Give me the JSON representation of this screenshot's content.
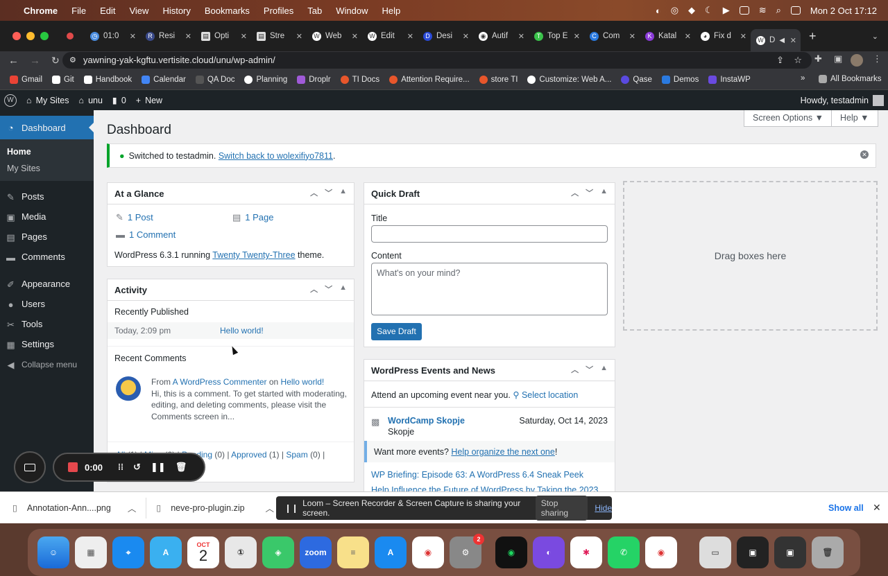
{
  "menubar": {
    "app": "Chrome",
    "menus": [
      "File",
      "Edit",
      "View",
      "History",
      "Bookmarks",
      "Profiles",
      "Tab",
      "Window",
      "Help"
    ],
    "datetime": "Mon 2 Oct  17:12"
  },
  "tabs": [
    {
      "label": "01:0",
      "icon": "clock-icon"
    },
    {
      "label": "Resi",
      "icon": "rm-icon"
    },
    {
      "label": "Opti",
      "icon": "doc-icon"
    },
    {
      "label": "Stre",
      "icon": "doc-icon"
    },
    {
      "label": "Web",
      "icon": "wordpress-icon"
    },
    {
      "label": "Edit",
      "icon": "wordpress-icon"
    },
    {
      "label": "Desi",
      "icon": "d-icon"
    },
    {
      "label": "Autif",
      "icon": "autify-icon"
    },
    {
      "label": "Top E",
      "icon": "top-icon"
    },
    {
      "label": "Com",
      "icon": "c-icon"
    },
    {
      "label": "Katal",
      "icon": "k-icon"
    },
    {
      "label": "Fix d",
      "icon": "github-icon"
    },
    {
      "label": "D",
      "icon": "wordpress-icon"
    }
  ],
  "address": "yawning-yak-kgftu.vertisite.cloud/unu/wp-admin/",
  "bookmarks": [
    {
      "label": "Gmail",
      "color": "#ea4335"
    },
    {
      "label": "Git",
      "color": "#ffffff"
    },
    {
      "label": "Handbook",
      "color": "#ffffff"
    },
    {
      "label": "Calendar",
      "color": "#4285f4"
    },
    {
      "label": "QA Doc",
      "color": "#888888"
    },
    {
      "label": "Planning",
      "color": "#ffffff"
    },
    {
      "label": "Droplr",
      "color": "#a05ad8"
    },
    {
      "label": "TI Docs",
      "color": "#e8562b"
    },
    {
      "label": "Attention Require...",
      "color": "#e8562b"
    },
    {
      "label": "store TI",
      "color": "#e8562b"
    },
    {
      "label": "Customize: Web A...",
      "color": "#ffffff"
    },
    {
      "label": "Qase",
      "color": "#5a4ae0"
    },
    {
      "label": "Demos",
      "color": "#2a7ae0"
    },
    {
      "label": "InstaWP",
      "color": "#6a4ae0"
    }
  ],
  "all_bookmarks": "All Bookmarks",
  "adminbar": {
    "my_sites": "My Sites",
    "site": "unu",
    "comments_count": "0",
    "new": "New",
    "howdy": "Howdy, testadmin"
  },
  "sidebar": {
    "dashboard": "Dashboard",
    "home": "Home",
    "my_sites": "My Sites",
    "items": [
      {
        "label": "Posts",
        "icon": "pin-icon"
      },
      {
        "label": "Media",
        "icon": "media-icon"
      },
      {
        "label": "Pages",
        "icon": "pages-icon"
      },
      {
        "label": "Comments",
        "icon": "comment-icon"
      },
      {
        "label": "Appearance",
        "icon": "brush-icon"
      },
      {
        "label": "Users",
        "icon": "user-icon"
      },
      {
        "label": "Tools",
        "icon": "wrench-icon"
      },
      {
        "label": "Settings",
        "icon": "settings-icon"
      }
    ],
    "collapse": "Collapse menu"
  },
  "page": {
    "title": "Dashboard",
    "screen_options": "Screen Options ▼",
    "help": "Help ▼"
  },
  "notice": {
    "text": "Switched to testadmin.",
    "link": "Switch back to wolexifiyo7811",
    "tail": "."
  },
  "glance": {
    "title": "At a Glance",
    "posts": "1 Post",
    "pages": "1 Page",
    "comments": "1 Comment",
    "version_pre": "WordPress 6.3.1 running",
    "theme": "Twenty Twenty-Three",
    "version_post": "theme."
  },
  "activity": {
    "title": "Activity",
    "recent_published": "Recently Published",
    "date": "Today, 2:09 pm",
    "post": "Hello world!",
    "recent_comments": "Recent Comments",
    "from": "From",
    "commenter": "A WordPress Commenter",
    "on": "on",
    "comment_post": "Hello world!",
    "excerpt": "Hi, this is a comment. To get started with moderating, editing, and deleting comments, please visit the Comments screen in...",
    "filters": [
      {
        "label": "All",
        "count": "(1)"
      },
      {
        "label": "Mine",
        "count": "(0)"
      },
      {
        "label": "Pending",
        "count": "(0)"
      },
      {
        "label": "Approved",
        "count": "(1)"
      },
      {
        "label": "Spam",
        "count": "(0)"
      }
    ]
  },
  "quick_draft": {
    "title": "Quick Draft",
    "title_label": "Title",
    "content_label": "Content",
    "content_placeholder": "What's on your mind?",
    "save": "Save Draft"
  },
  "drag": "Drag boxes here",
  "events": {
    "title": "WordPress Events and News",
    "attend": "Attend an upcoming event near you.",
    "select_location": "Select location",
    "event_name": "WordCamp Skopje",
    "event_city": "Skopje",
    "event_date": "Saturday, Oct 14, 2023",
    "want_more": "Want more events?",
    "organize": "Help organize the next one",
    "organize_tail": "!",
    "news1": "WP Briefing: Episode 63: A WordPress 6.4 Sneak Peek",
    "news2": "Help Influence the Future of WordPress by Taking the 2023"
  },
  "recorder": {
    "time": "0:00"
  },
  "downloads": {
    "file1": "Annotation-Ann....png",
    "file2": "neve-pro-plugin.zip",
    "loom": "Loom – Screen Recorder & Screen Capture is sharing your screen.",
    "stop": "Stop sharing",
    "hide": "Hide",
    "show_all": "Show all"
  },
  "dock": {
    "calendar_month": "OCT",
    "calendar_day": "2",
    "zoom": "zoom",
    "badge": "2"
  }
}
